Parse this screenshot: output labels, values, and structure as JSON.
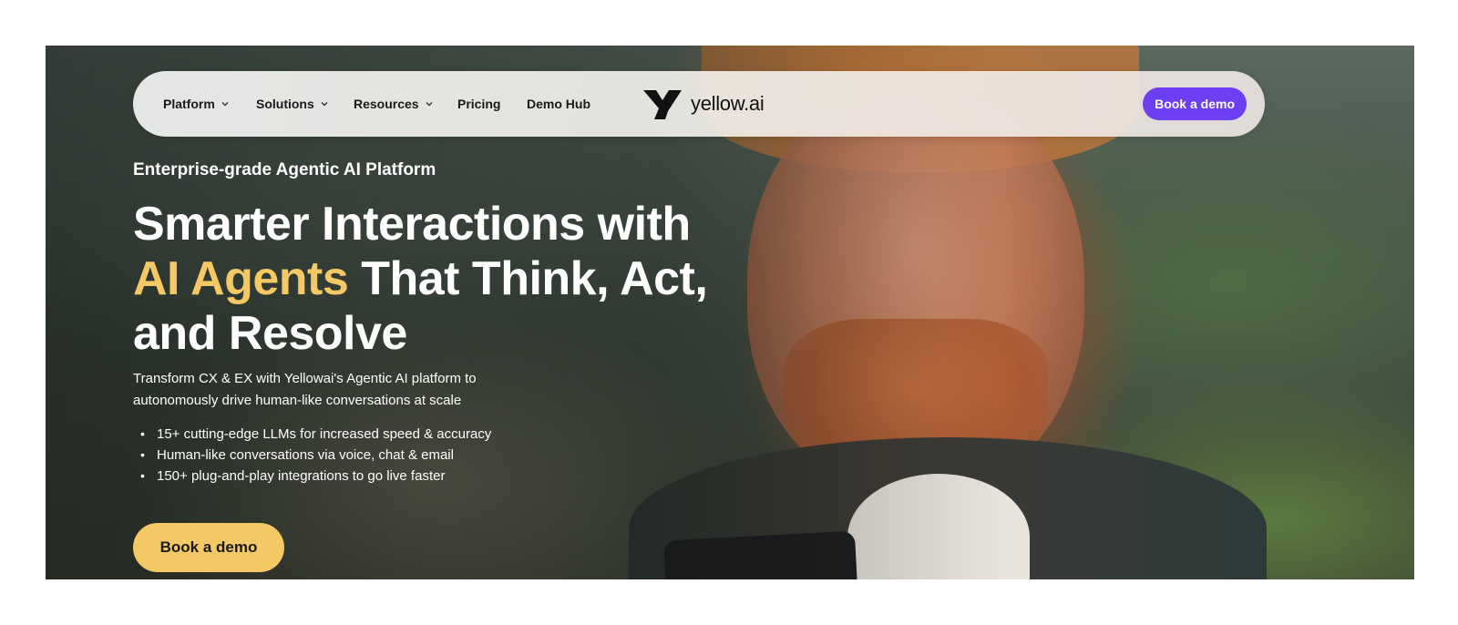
{
  "nav": {
    "items": [
      {
        "label": "Platform",
        "has_dropdown": true
      },
      {
        "label": "Solutions",
        "has_dropdown": true
      },
      {
        "label": "Resources",
        "has_dropdown": true
      },
      {
        "label": "Pricing",
        "has_dropdown": false
      },
      {
        "label": "Demo Hub",
        "has_dropdown": false
      }
    ],
    "logo_text": "yellow.ai",
    "cta_label": "Book a demo"
  },
  "hero": {
    "eyebrow": "Enterprise-grade Agentic AI Platform",
    "headline_part1": "Smarter Interactions with",
    "headline_accent": "AI Agents",
    "headline_part2": " That Think, Act, and Resolve",
    "subtext": "Transform CX & EX with Yellowai's Agentic AI platform to autonomously drive human-like conversations at scale",
    "bullets": [
      "15+ cutting-edge LLMs for increased speed & accuracy",
      "Human-like conversations via voice, chat & email",
      "150+ plug-and-play integrations to go live faster"
    ],
    "cta_label": "Book a demo"
  },
  "colors": {
    "accent_yellow": "#f3c865",
    "nav_cta_purple": "#6c3ff2"
  },
  "icons": {
    "dropdown": "chevron-down-icon",
    "logo": "yellow-ai-logo-icon"
  }
}
